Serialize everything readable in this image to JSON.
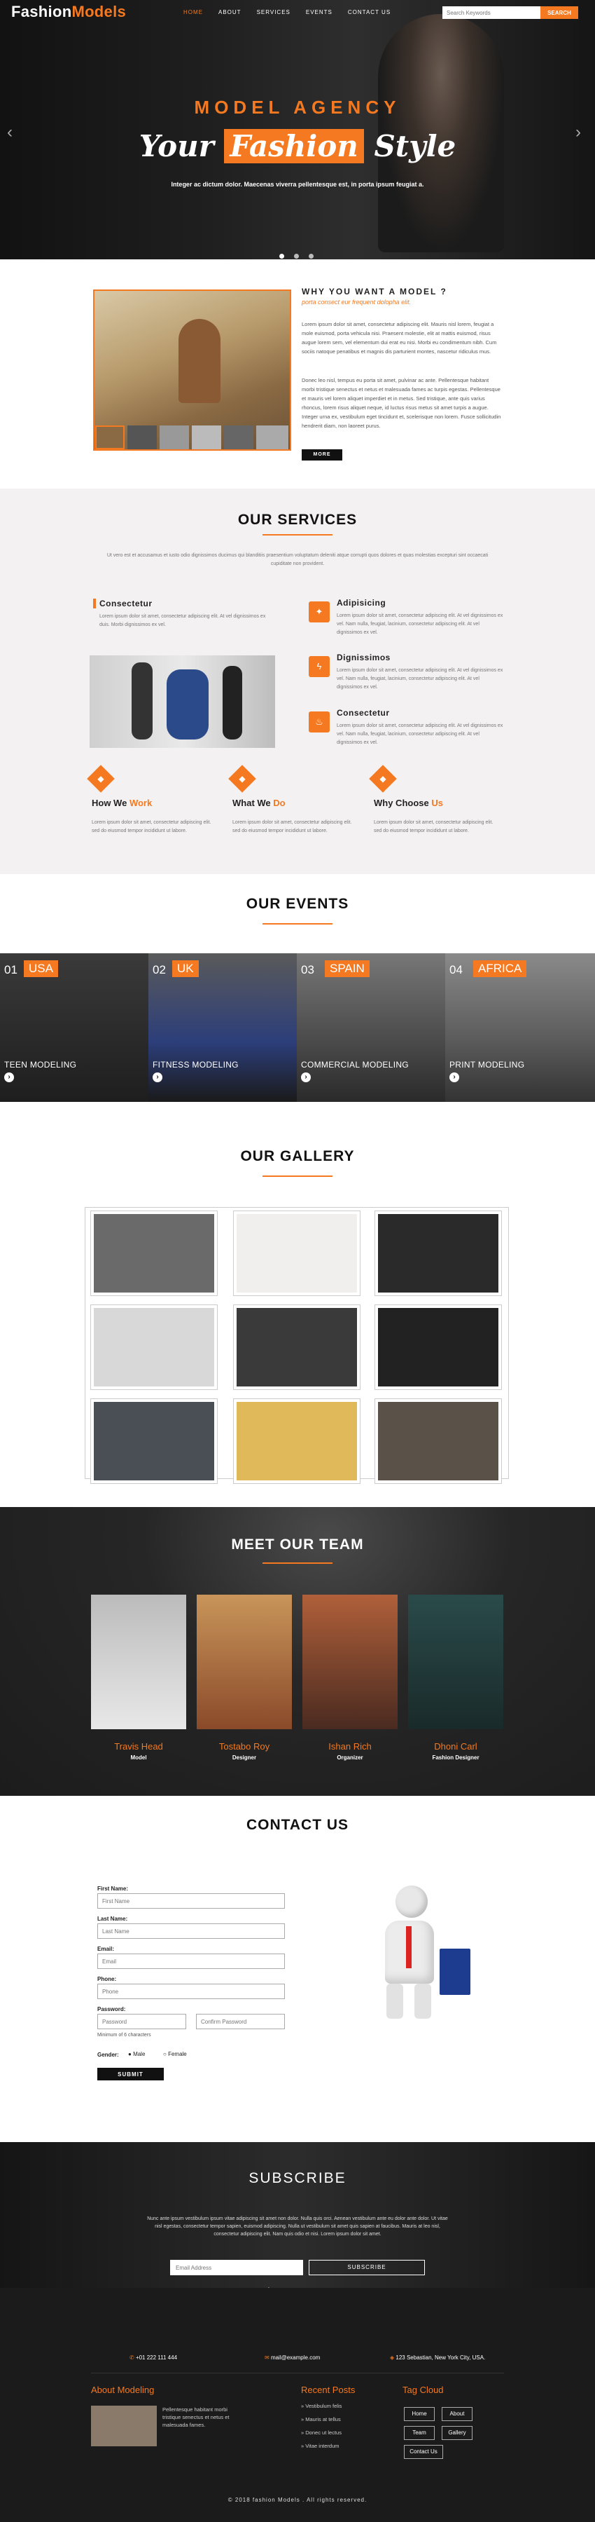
{
  "brand": {
    "part1": "Fashion",
    "part2": "Models"
  },
  "nav": [
    "HOME",
    "ABOUT",
    "SERVICES",
    "EVENTS",
    "CONTACT US"
  ],
  "search": {
    "placeholder": "Search Keywords",
    "button": "SEARCH"
  },
  "hero": {
    "kicker": "MODEL AGENCY",
    "title_pre": "Your",
    "title_hl": "Fashion",
    "title_post": "Style",
    "subtitle": "Integer ac dictum dolor. Maecenas viverra pellentesque est, in porta ipsum feugiat a."
  },
  "why": {
    "heading": "WHY YOU WANT A MODEL ?",
    "subheading": "porta consect eur frequent dolopha elit.",
    "p1": "Lorem ipsum dolor sit amet, consectetur adipiscing elit. Mauris nisl lorem, feugiat a mole euismod, porta vehicula nisi. Praesent molestie, elit at mattis euismod, risus augue lorem sem, vel elementum dui erat eu nisi. Morbi eu condimentum nibh. Cum sociis natoque penatibus et magnis dis parturient montes, nascetur ridiculus mus.",
    "p2": "Donec leo nisl, tempus eu porta sit amet, pulvinar ac ante. Pellentesque habitant morbi tristique senectus et netus et malesuada fames ac turpis egestas. Pellentesque et mauris vel lorem aliquet imperdiet et in metus. Sed tristique, ante quis varius rhoncus, lorem risus aliquet neque, id luctus risus metus sit amet turpis a augue. Integer urna ex, vestibulum eget tincidunt et, scelerisque non lorem. Fusce sollicitudin hendrerit diam, non laoreet purus.",
    "button": "MORE"
  },
  "services": {
    "title": "OUR SERVICES",
    "intro": "Ut vero est et accusamus et iusto odio dignissimos ducimus qui blanditiis praesentium voluptatum deleniti atque corrupti quos dolores et quas molestias excepturi sint occaecati cupiditate non provident.",
    "left": {
      "title": "Consectetur",
      "text": "Lorem ipsum dolor sit amet, consectetur adipiscing elit. At vel dignissimos ex duis. Morbi dignissimos ex vel."
    },
    "items": [
      {
        "title": "Adipisicing",
        "text": "Lorem ipsum dolor sit amet, consectetur adipiscing elit. At vel dignissimos ex vel. Nam nulla, feugiat, lacinium, consectetur adipiscing elit. At vel dignissimos ex vel.",
        "icon": "bulb-icon"
      },
      {
        "title": "Dignissimos",
        "text": "Lorem ipsum dolor sit amet, consectetur adipiscing elit. At vel dignissimos ex vel. Nam nulla, feugiat, lacinium, consectetur adipiscing elit. At vel dignissimos ex vel.",
        "icon": "bolt-icon"
      },
      {
        "title": "Consectetur",
        "text": "Lorem ipsum dolor sit amet, consectetur adipiscing elit. At vel dignissimos ex vel. Nam nulla, feugiat, lacinium, consectetur adipiscing elit. At vel dignissimos ex vel.",
        "icon": "flame-icon"
      }
    ],
    "how": [
      {
        "a": "How We",
        "b": "Work",
        "text": "Lorem ipsum dolor sit amet, consectetur adipiscing elit. sed do eiusmod tempor incididunt ut labore."
      },
      {
        "a": "What We",
        "b": "Do",
        "text": "Lorem ipsum dolor sit amet, consectetur adipiscing elit. sed do eiusmod tempor incididunt ut labore."
      },
      {
        "a": "Why Choose",
        "b": "Us",
        "text": "Lorem ipsum dolor sit amet, consectetur adipiscing elit. sed do eiusmod tempor incididunt ut labore."
      }
    ]
  },
  "events": {
    "title": "OUR EVENTS",
    "items": [
      {
        "num": "01",
        "tag": "USA",
        "name": "TEEN MODELING"
      },
      {
        "num": "02",
        "tag": "UK",
        "name": "FITNESS MODELING"
      },
      {
        "num": "03",
        "tag": "SPAIN",
        "name": "COMMERCIAL MODELING"
      },
      {
        "num": "04",
        "tag": "AFRICA",
        "name": "PRINT MODELING"
      }
    ]
  },
  "gallery": {
    "title": "OUR GALLERY"
  },
  "team": {
    "title": "MEET OUR TEAM",
    "members": [
      {
        "name": "Travis Head",
        "role": "Model"
      },
      {
        "name": "Tostabo Roy",
        "role": "Designer"
      },
      {
        "name": "Ishan Rich",
        "role": "Organizer"
      },
      {
        "name": "Dhoni Carl",
        "role": "Fashion Designer"
      }
    ]
  },
  "contact": {
    "title": "CONTACT US",
    "first_label": "First Name:",
    "first_ph": "First Name",
    "last_label": "Last Name:",
    "last_ph": "Last Name",
    "email_label": "Email:",
    "email_ph": "Email",
    "phone_label": "Phone:",
    "phone_ph": "Phone",
    "pw_label": "Password:",
    "pw_ph": "Password",
    "cpw_ph": "Confirm Password",
    "pw_hint": "Minimum of 6 characters",
    "gender_label": "Gender:",
    "male": "Male",
    "female": "Female",
    "submit": "SUBMIT"
  },
  "subscribe": {
    "title": "SUBSCRIBE",
    "text": "Nunc ante ipsum vestibulum ipsum vitae adipiscing sit amet non dolor. Nulla quis orci. Aenean vestibulum ante eu dolor ante dolor. Ut vitae nisl egestas, consectetur tempor sapien, euismod adipiscing. Nulla ut vestibulum sit amet quis sapien at faucibus. Mauris at leo nisl, consectetur adipiscing elit. Nam quis odio et nisi. Lorem ipsum dolor sit amet.",
    "placeholder": "Email Address",
    "button": "SUBSCRIBE"
  },
  "footer": {
    "phone": "+01 222 111 444",
    "email": "mail@example.com",
    "address": "123 Sebastian, New York City, USA.",
    "about_title": "About Modeling",
    "about_text": "Pellentesque habitant morbi tristique senectus et netus et malesuada fames.",
    "recent_title": "Recent Posts",
    "recent": [
      "Vestibulum felis",
      "Mauris at tellus",
      "Donec ut lectus",
      "Vitae interdum"
    ],
    "tags_title": "Tag Cloud",
    "tags": [
      "Home",
      "About",
      "Team",
      "Gallery",
      "Contact Us"
    ],
    "copyright": "© 2018 fashion Models . All rights reserved."
  }
}
